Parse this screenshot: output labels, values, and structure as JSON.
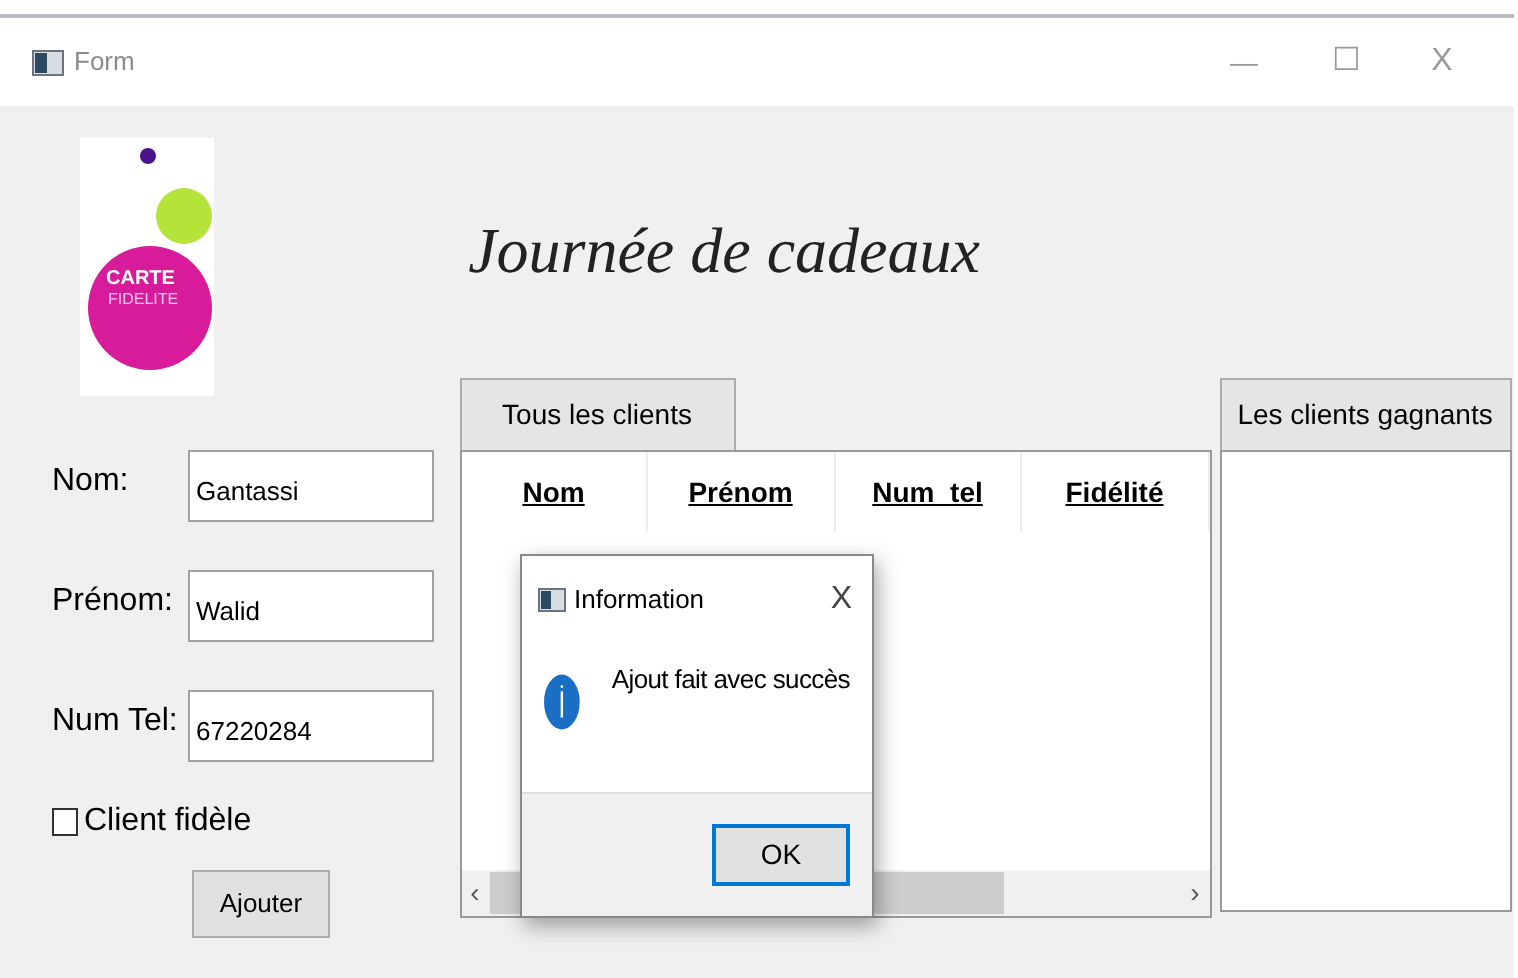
{
  "window": {
    "title": "Form",
    "controls": {
      "minimize": "—",
      "maximize": "☐",
      "close": "X"
    }
  },
  "logo": {
    "line1": "CARTE",
    "line2": "FIDELITE"
  },
  "heading": "Journée de cadeaux",
  "form": {
    "fields": [
      {
        "label": "Nom:",
        "value": "Gantassi"
      },
      {
        "label": "Prénom:",
        "value": "Walid"
      },
      {
        "label": "Num Tel:",
        "value": "67220284"
      }
    ],
    "checkbox": {
      "label": "Client fidèle",
      "checked": false
    },
    "submit": "Ajouter"
  },
  "all_clients": {
    "title": "Tous les clients",
    "columns": [
      "Nom",
      "Prénom",
      "Num_tel",
      "Fidélité"
    ],
    "scroll_left": "‹",
    "scroll_right": "›"
  },
  "winners": {
    "title": "Les clients gagnants"
  },
  "dialog": {
    "title": "Information",
    "close": "X",
    "message": "Ajout fait avec succès",
    "button": "OK"
  }
}
